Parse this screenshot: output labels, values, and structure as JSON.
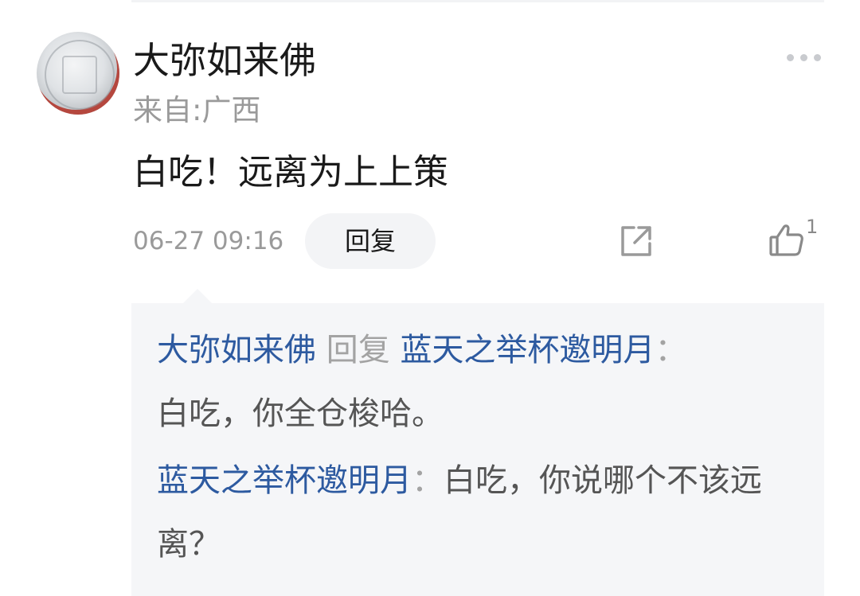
{
  "comment": {
    "username": "大弥如来佛",
    "location": "来自:广西",
    "content": "白吃！远离为上上策",
    "timestamp": "06-27 09:16",
    "reply_label": "回复",
    "like_count": "1"
  },
  "replies": [
    {
      "from": "大弥如来佛",
      "reply_word": "回复",
      "to": "蓝天之举杯邀明月",
      "separator": "：",
      "text": "白吃，你全仓梭哈。"
    },
    {
      "from": "蓝天之举杯邀明月",
      "separator": "：",
      "text": "白吃，你说哪个不该远离？"
    }
  ],
  "icons": {
    "more": "more-dots-icon",
    "share": "share-icon",
    "like": "thumbs-up-icon"
  },
  "colors": {
    "link": "#2d5aa0",
    "muted": "#9a9a9a",
    "panel_bg": "#f5f6f8"
  }
}
